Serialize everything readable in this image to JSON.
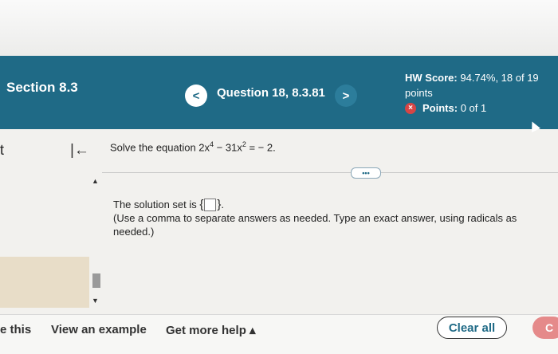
{
  "header": {
    "section_title": "Section 8.3",
    "section_sub": "",
    "question_title": "Question 18, 8.3.81",
    "prev_icon": "<",
    "next_icon": ">",
    "hw_score_label": "HW Score:",
    "hw_score_value": "94.74%, 18 of 19",
    "hw_score_line2": "points",
    "points_label": "Points:",
    "points_value": "0 of 1",
    "points_icon": "×"
  },
  "sidebar": {
    "left_letter": "t",
    "first_icon": "|←"
  },
  "question": {
    "prefix": "Solve the equation 2x",
    "exp1": "4",
    "mid": " − 31x",
    "exp2": "2",
    "suffix": " = − 2.",
    "more_label": "•••"
  },
  "solution": {
    "line1_prefix": "The solution set is ",
    "brace_open": "{",
    "brace_close": "}",
    "line1_suffix": ".",
    "line2": "(Use a comma to separate answers as needed. Type an exact answer, using radicals as needed.)"
  },
  "footer": {
    "help_label": "e this",
    "example_label": "View an example",
    "more_help_label": "Get more help ▴",
    "clear_all_label": "Clear all",
    "check_label": "C"
  },
  "colors": {
    "header_bg": "#1f6a86",
    "accent": "#1f6a86"
  }
}
